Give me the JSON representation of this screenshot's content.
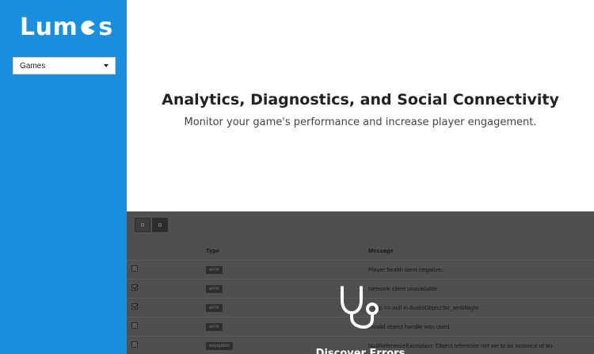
{
  "app": {
    "logo_prefix": "Lum",
    "logo_suffix": "s",
    "logo_icon": "lumos-o-icon",
    "accent_color": "#1a8fdd"
  },
  "sidebar": {
    "select_value": "Games",
    "select_icon": "chevron-down-icon"
  },
  "hero": {
    "title": "Analytics, Diagnostics, and Social Connectivity",
    "subtitle": "Monitor your game's performance and increase player engagement."
  },
  "preview": {
    "toolbar_icons": [
      "list-view-icon",
      "grid-view-icon"
    ],
    "columns": {
      "check": "",
      "type": "Type",
      "message": "Message"
    },
    "rows": [
      {
        "checked": false,
        "type": "error",
        "message": "Player health went negative."
      },
      {
        "checked": true,
        "type": "error",
        "message": "Network client unavailable."
      },
      {
        "checked": true,
        "type": "error",
        "message": "...clip == null in AudioObject:bv_ambNight"
      },
      {
        "checked": false,
        "type": "error",
        "message": "Invalid object handle was used."
      },
      {
        "checked": false,
        "type": "exception",
        "message": "NullReferenceException: Object reference not set to an instance of an"
      }
    ],
    "overlay_icon": "stethoscope-icon",
    "overlay_label": "Discover Errors"
  }
}
